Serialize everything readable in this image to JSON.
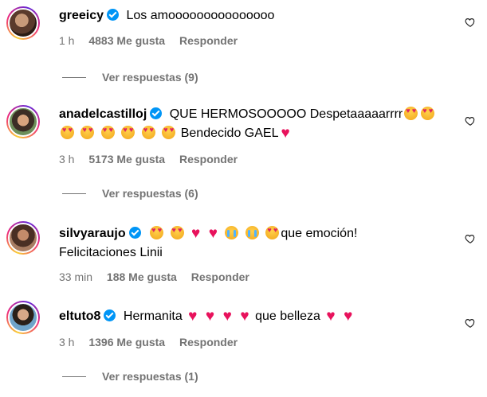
{
  "comments": [
    {
      "username": "greeicy",
      "text": "Los amooooooooooooooo",
      "time": "1 h",
      "likes": "4883 Me gusta",
      "reply": "Responder",
      "replies": "Ver respuestas (9)"
    },
    {
      "username": "anadelcastilloj",
      "text_a": "QUE HERMOSOOOOO Despetaaaaarrrr",
      "text_b": "Bendecido GAEL",
      "time": "3 h",
      "likes": "5173 Me gusta",
      "reply": "Responder",
      "replies": "Ver respuestas (6)"
    },
    {
      "username": "silvyaraujo",
      "text_a": "que emoción!",
      "text_b": "Felicitaciones Linii",
      "time": "33 min",
      "likes": "188 Me gusta",
      "reply": "Responder"
    },
    {
      "username": "eltuto8",
      "text_a": "Hermanita",
      "text_b": "que belleza",
      "time": "3 h",
      "likes": "1396 Me gusta",
      "reply": "Responder",
      "replies": "Ver respuestas (1)"
    }
  ],
  "colors": {
    "verified": "#0095f6",
    "meta": "#737373",
    "heart": "#e8125c"
  },
  "icons": {
    "like": "heart-outline-icon",
    "verified": "verified-badge-icon"
  }
}
